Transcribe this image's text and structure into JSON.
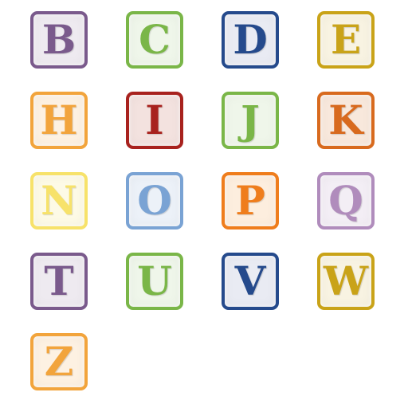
{
  "tiles": [
    {
      "letter": "B",
      "color": "#7a5a8c",
      "bg": "#eeeaf0"
    },
    {
      "letter": "C",
      "color": "#7ab648",
      "bg": "#eff6ea"
    },
    {
      "letter": "D",
      "color": "#254a8c",
      "bg": "#e9ebf3"
    },
    {
      "letter": "E",
      "color": "#c9a318",
      "bg": "#f8f3e2"
    },
    {
      "letter": "H",
      "color": "#f2a43c",
      "bg": "#fdf1e2"
    },
    {
      "letter": "I",
      "color": "#a8221e",
      "bg": "#f3e2df"
    },
    {
      "letter": "J",
      "color": "#7ab648",
      "bg": "#eff6ea"
    },
    {
      "letter": "K",
      "color": "#d86a1e",
      "bg": "#f8e8dc"
    },
    {
      "letter": "N",
      "color": "#f7e26a",
      "bg": "#fdfae6"
    },
    {
      "letter": "O",
      "color": "#7aa3d4",
      "bg": "#ecf1f8"
    },
    {
      "letter": "P",
      "color": "#ef7d1c",
      "bg": "#fdeede"
    },
    {
      "letter": "Q",
      "color": "#b08cbc",
      "bg": "#f3eef5"
    },
    {
      "letter": "T",
      "color": "#7a5a8c",
      "bg": "#eeeaf0"
    },
    {
      "letter": "U",
      "color": "#7ab648",
      "bg": "#eff6ea"
    },
    {
      "letter": "V",
      "color": "#254a8c",
      "bg": "#e9ebf3"
    },
    {
      "letter": "W",
      "color": "#c9a318",
      "bg": "#f8f3e2"
    },
    {
      "letter": "Z",
      "color": "#f2a43c",
      "bg": "#fdf1e2"
    }
  ]
}
